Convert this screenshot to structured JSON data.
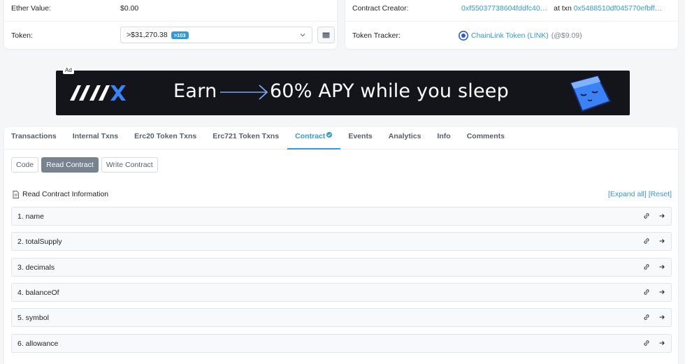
{
  "overview": {
    "ether_value_label": "Ether Value:",
    "ether_value": "$0.00",
    "token_label": "Token:",
    "token_value": ">$31,270.38",
    "token_count_badge": ">103"
  },
  "contract_info": {
    "creator_label": "Contract Creator:",
    "creator_address": "0xf55037738604fddfc40…",
    "at_txn_label": "at txn",
    "txn_hash": "0x5488510df045770efbff…",
    "tracker_label": "Token Tracker:",
    "tracker_name": "ChainLink Token (LINK)",
    "tracker_price": "(@$9.09)"
  },
  "ad": {
    "label": "Ad",
    "brand": "AAX",
    "headline_earn": "Earn",
    "headline_rest": "60% APY while you sleep"
  },
  "tabs": [
    {
      "label": "Transactions"
    },
    {
      "label": "Internal Txns"
    },
    {
      "label": "Erc20 Token Txns"
    },
    {
      "label": "Erc721 Token Txns"
    },
    {
      "label": "Contract"
    },
    {
      "label": "Events"
    },
    {
      "label": "Analytics"
    },
    {
      "label": "Info"
    },
    {
      "label": "Comments"
    }
  ],
  "active_tab": "Contract",
  "subtabs": [
    {
      "label": "Code"
    },
    {
      "label": "Read Contract"
    },
    {
      "label": "Write Contract"
    }
  ],
  "read_contract": {
    "title": "Read Contract Information",
    "expand_all": "[Expand all]",
    "reset": "[Reset]",
    "functions": [
      {
        "label": "1. name"
      },
      {
        "label": "2. totalSupply"
      },
      {
        "label": "3. decimals"
      },
      {
        "label": "4. balanceOf"
      },
      {
        "label": "5. symbol"
      },
      {
        "label": "6. allowance"
      }
    ]
  },
  "colors": {
    "accent": "#3498db",
    "page_bg": "#f5f6f8",
    "ad_bg": "#14151a",
    "mascot": "#3b82f6"
  }
}
